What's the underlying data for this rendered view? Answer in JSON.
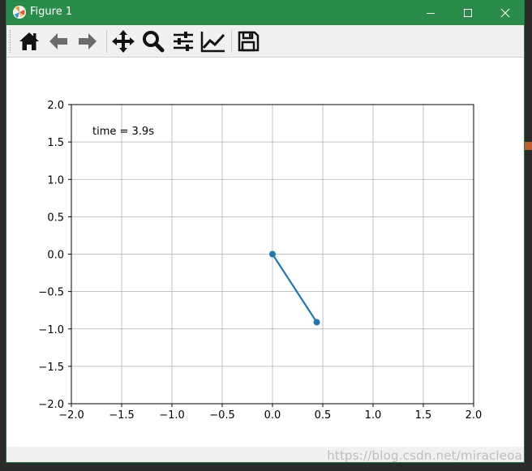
{
  "window": {
    "title": "Figure 1",
    "titlebar_color": "#2a8c4a",
    "controls": {
      "minimize_icon": "minimize-icon",
      "maximize_icon": "maximize-icon",
      "close_icon": "close-icon"
    }
  },
  "toolbar": {
    "buttons": [
      {
        "name": "home",
        "icon": "home-icon"
      },
      {
        "name": "back",
        "icon": "arrow-left-icon"
      },
      {
        "name": "forward",
        "icon": "arrow-right-icon"
      },
      {
        "name": "pan",
        "icon": "move-icon"
      },
      {
        "name": "zoom",
        "icon": "magnifier-icon"
      },
      {
        "name": "configure-subplots",
        "icon": "sliders-icon"
      },
      {
        "name": "edit-axis",
        "icon": "line-chart-icon"
      },
      {
        "name": "save",
        "icon": "floppy-disk-icon"
      }
    ]
  },
  "chart_data": {
    "type": "line",
    "series": [
      {
        "x": [
          0.0,
          0.44
        ],
        "y": [
          0.0,
          -0.91
        ],
        "color": "#1f77b4",
        "marker": "circle"
      }
    ],
    "annotation": "time = 3.9s",
    "xlim": [
      -2.0,
      2.0
    ],
    "ylim": [
      -2.0,
      2.0
    ],
    "xticks": [
      -2.0,
      -1.5,
      -1.0,
      -0.5,
      0.0,
      0.5,
      1.0,
      1.5,
      2.0
    ],
    "yticks": [
      -2.0,
      -1.5,
      -1.0,
      -0.5,
      0.0,
      0.5,
      1.0,
      1.5,
      2.0
    ],
    "xtick_labels": [
      "−2.0",
      "−1.5",
      "−1.0",
      "−0.5",
      "0.0",
      "0.5",
      "1.0",
      "1.5",
      "2.0"
    ],
    "ytick_labels": [
      "−2.0",
      "−1.5",
      "−1.0",
      "−0.5",
      "0.0",
      "0.5",
      "1.0",
      "1.5",
      "2.0"
    ],
    "grid": true
  },
  "watermark": "https://blog.csdn.net/miracleoa"
}
